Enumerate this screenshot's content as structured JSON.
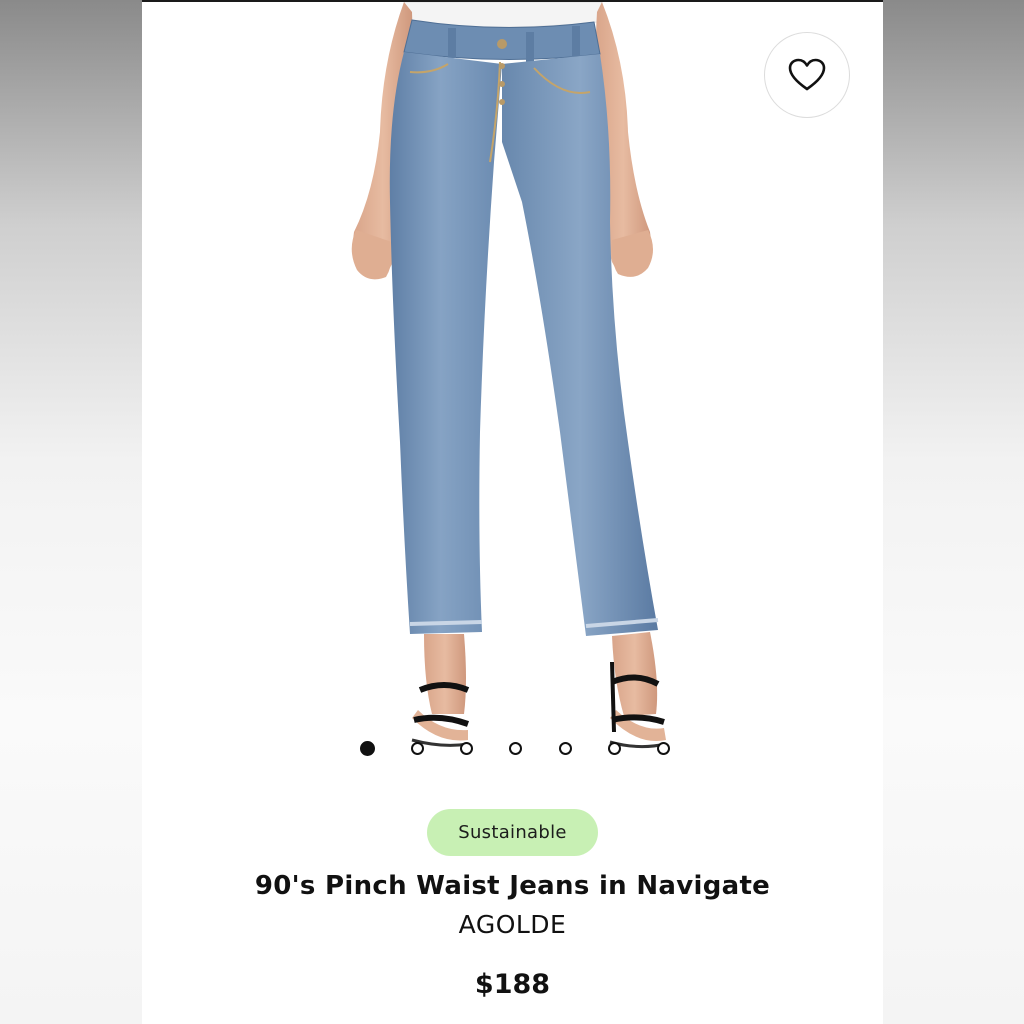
{
  "product": {
    "badge": "Sustainable",
    "title": "90's Pinch Waist Jeans in Navigate",
    "brand": "AGOLDE",
    "price": "$188",
    "image_icon": "jeans-photo",
    "favorite_icon": "heart-outline-icon"
  },
  "carousel": {
    "total_images": 7,
    "active_index": 0
  },
  "colors": {
    "badge_bg": "#c8f0b4",
    "denim": "#6f8fb3",
    "text": "#111111"
  }
}
